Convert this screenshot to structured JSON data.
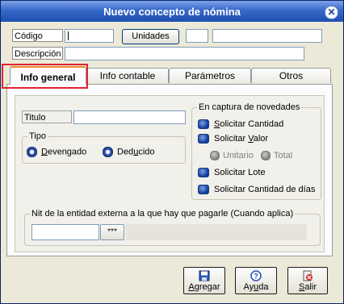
{
  "window": {
    "title": "Nuevo concepto de nómina",
    "close_glyph": "✕"
  },
  "header": {
    "codigo_label": "Código",
    "unidades_button": "Unidades",
    "descripcion_label": "Descripción"
  },
  "tabs": [
    {
      "label": "Info general",
      "active": true
    },
    {
      "label": "Info contable",
      "active": false
    },
    {
      "label": "Parámetros",
      "active": false
    },
    {
      "label": "Otros",
      "active": false
    }
  ],
  "general": {
    "titulo_label": "Titulo",
    "tipo": {
      "legend": "Tipo",
      "options": [
        {
          "label": "Devengado",
          "underline": "D",
          "rest": "evengado",
          "selected": true
        },
        {
          "label": "Deducido",
          "underline": "u",
          "pre": "Ded",
          "rest": "cido",
          "selected": false
        }
      ]
    },
    "captura": {
      "legend": "En captura de novedades",
      "items": [
        {
          "pre": "",
          "ul": "S",
          "rest": "olicitar Cantidad"
        },
        {
          "pre": "Solicitar ",
          "ul": "V",
          "rest": "alor"
        },
        {
          "pre": "Solicitar Lote",
          "ul": "",
          "rest": ""
        },
        {
          "pre": "Solicitar Cantidad de días",
          "ul": "",
          "rest": ""
        }
      ],
      "sub_options": [
        "Unitario",
        "Total"
      ]
    },
    "nit": {
      "legend": "Nit de la entidad externa a la que hay que pagarle (Cuando aplica)",
      "lookup_button": "***"
    }
  },
  "footer": {
    "agregar": {
      "ul": "A",
      "rest": "gregar",
      "icon": "save-disk-icon"
    },
    "ayuda": {
      "pre": "Ay",
      "ul": "u",
      "rest": "da",
      "icon": "help-icon"
    },
    "salir": {
      "ul": "S",
      "rest": "alir",
      "icon": "exit-icon"
    }
  },
  "colors": {
    "title_bar": "#1e4fb0",
    "highlight": "#e0232e",
    "tab_accent": "#e68b2c"
  }
}
